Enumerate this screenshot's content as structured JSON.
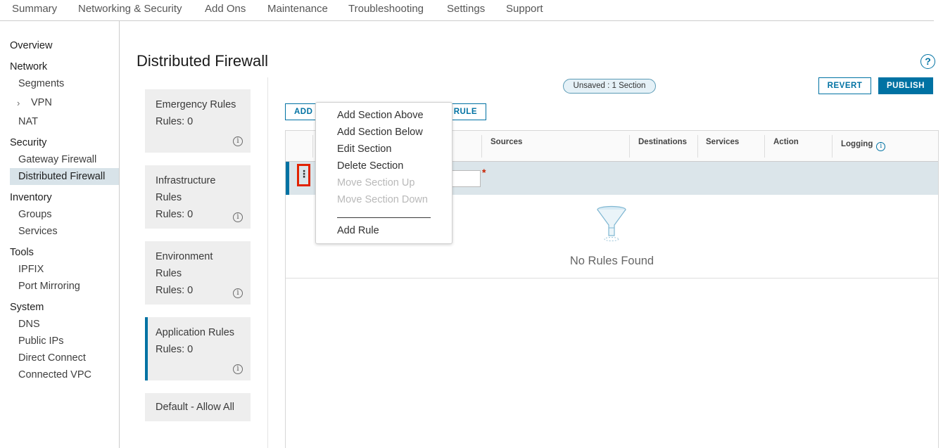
{
  "top_nav": [
    "Summary",
    "Networking & Security",
    "Add Ons",
    "Maintenance",
    "Troubleshooting",
    "Settings",
    "Support"
  ],
  "sidebar": {
    "overview": "Overview",
    "network": {
      "heading": "Network",
      "items": [
        "Segments",
        "VPN",
        "NAT"
      ]
    },
    "security": {
      "heading": "Security",
      "items": [
        "Gateway Firewall",
        "Distributed Firewall"
      ],
      "active": "Distributed Firewall"
    },
    "inventory": {
      "heading": "Inventory",
      "items": [
        "Groups",
        "Services"
      ]
    },
    "tools": {
      "heading": "Tools",
      "items": [
        "IPFIX",
        "Port Mirroring"
      ]
    },
    "system": {
      "heading": "System",
      "items": [
        "DNS",
        "Public IPs",
        "Direct Connect",
        "Connected VPC"
      ]
    }
  },
  "page": {
    "title": "Distributed Firewall",
    "help_glyph": "?"
  },
  "categories": [
    {
      "title": "Emergency Rules",
      "count": "Rules: 0"
    },
    {
      "title_line1": "Infrastructure",
      "title_line2": "Rules",
      "count": "Rules: 0"
    },
    {
      "title_line1": "Environment",
      "title_line2": "Rules",
      "count": "Rules: 0"
    },
    {
      "title": "Application Rules",
      "count": "Rules: 0",
      "active": true
    },
    {
      "title": "Default - Allow All"
    }
  ],
  "toolbar": {
    "unsaved_badge": "Unsaved : 1 Section",
    "revert": "REVERT",
    "publish": "PUBLISH",
    "add_section_partial": "ADD",
    "add_rule_partial": "RULE"
  },
  "grid": {
    "columns": [
      "Sources",
      "Destinations",
      "Services",
      "Action",
      "Logging"
    ],
    "empty_message": "No Rules Found",
    "kebab_glyph": "⋮",
    "required_mark": "*"
  },
  "context_menu": {
    "items": [
      {
        "label": "Add Section Above",
        "enabled": true
      },
      {
        "label": "Add Section Below",
        "enabled": true
      },
      {
        "label": "Edit Section",
        "enabled": true
      },
      {
        "label": "Delete Section",
        "enabled": true
      },
      {
        "label": "Move Section Up",
        "enabled": false
      },
      {
        "label": "Move Section Down",
        "enabled": false
      },
      {
        "label": "Add Rule",
        "enabled": true
      }
    ]
  },
  "colors": {
    "accent": "#0072a3",
    "highlight_border": "#e12200",
    "row_selected": "#dbe5ea",
    "card_bg": "#eeeeee"
  }
}
